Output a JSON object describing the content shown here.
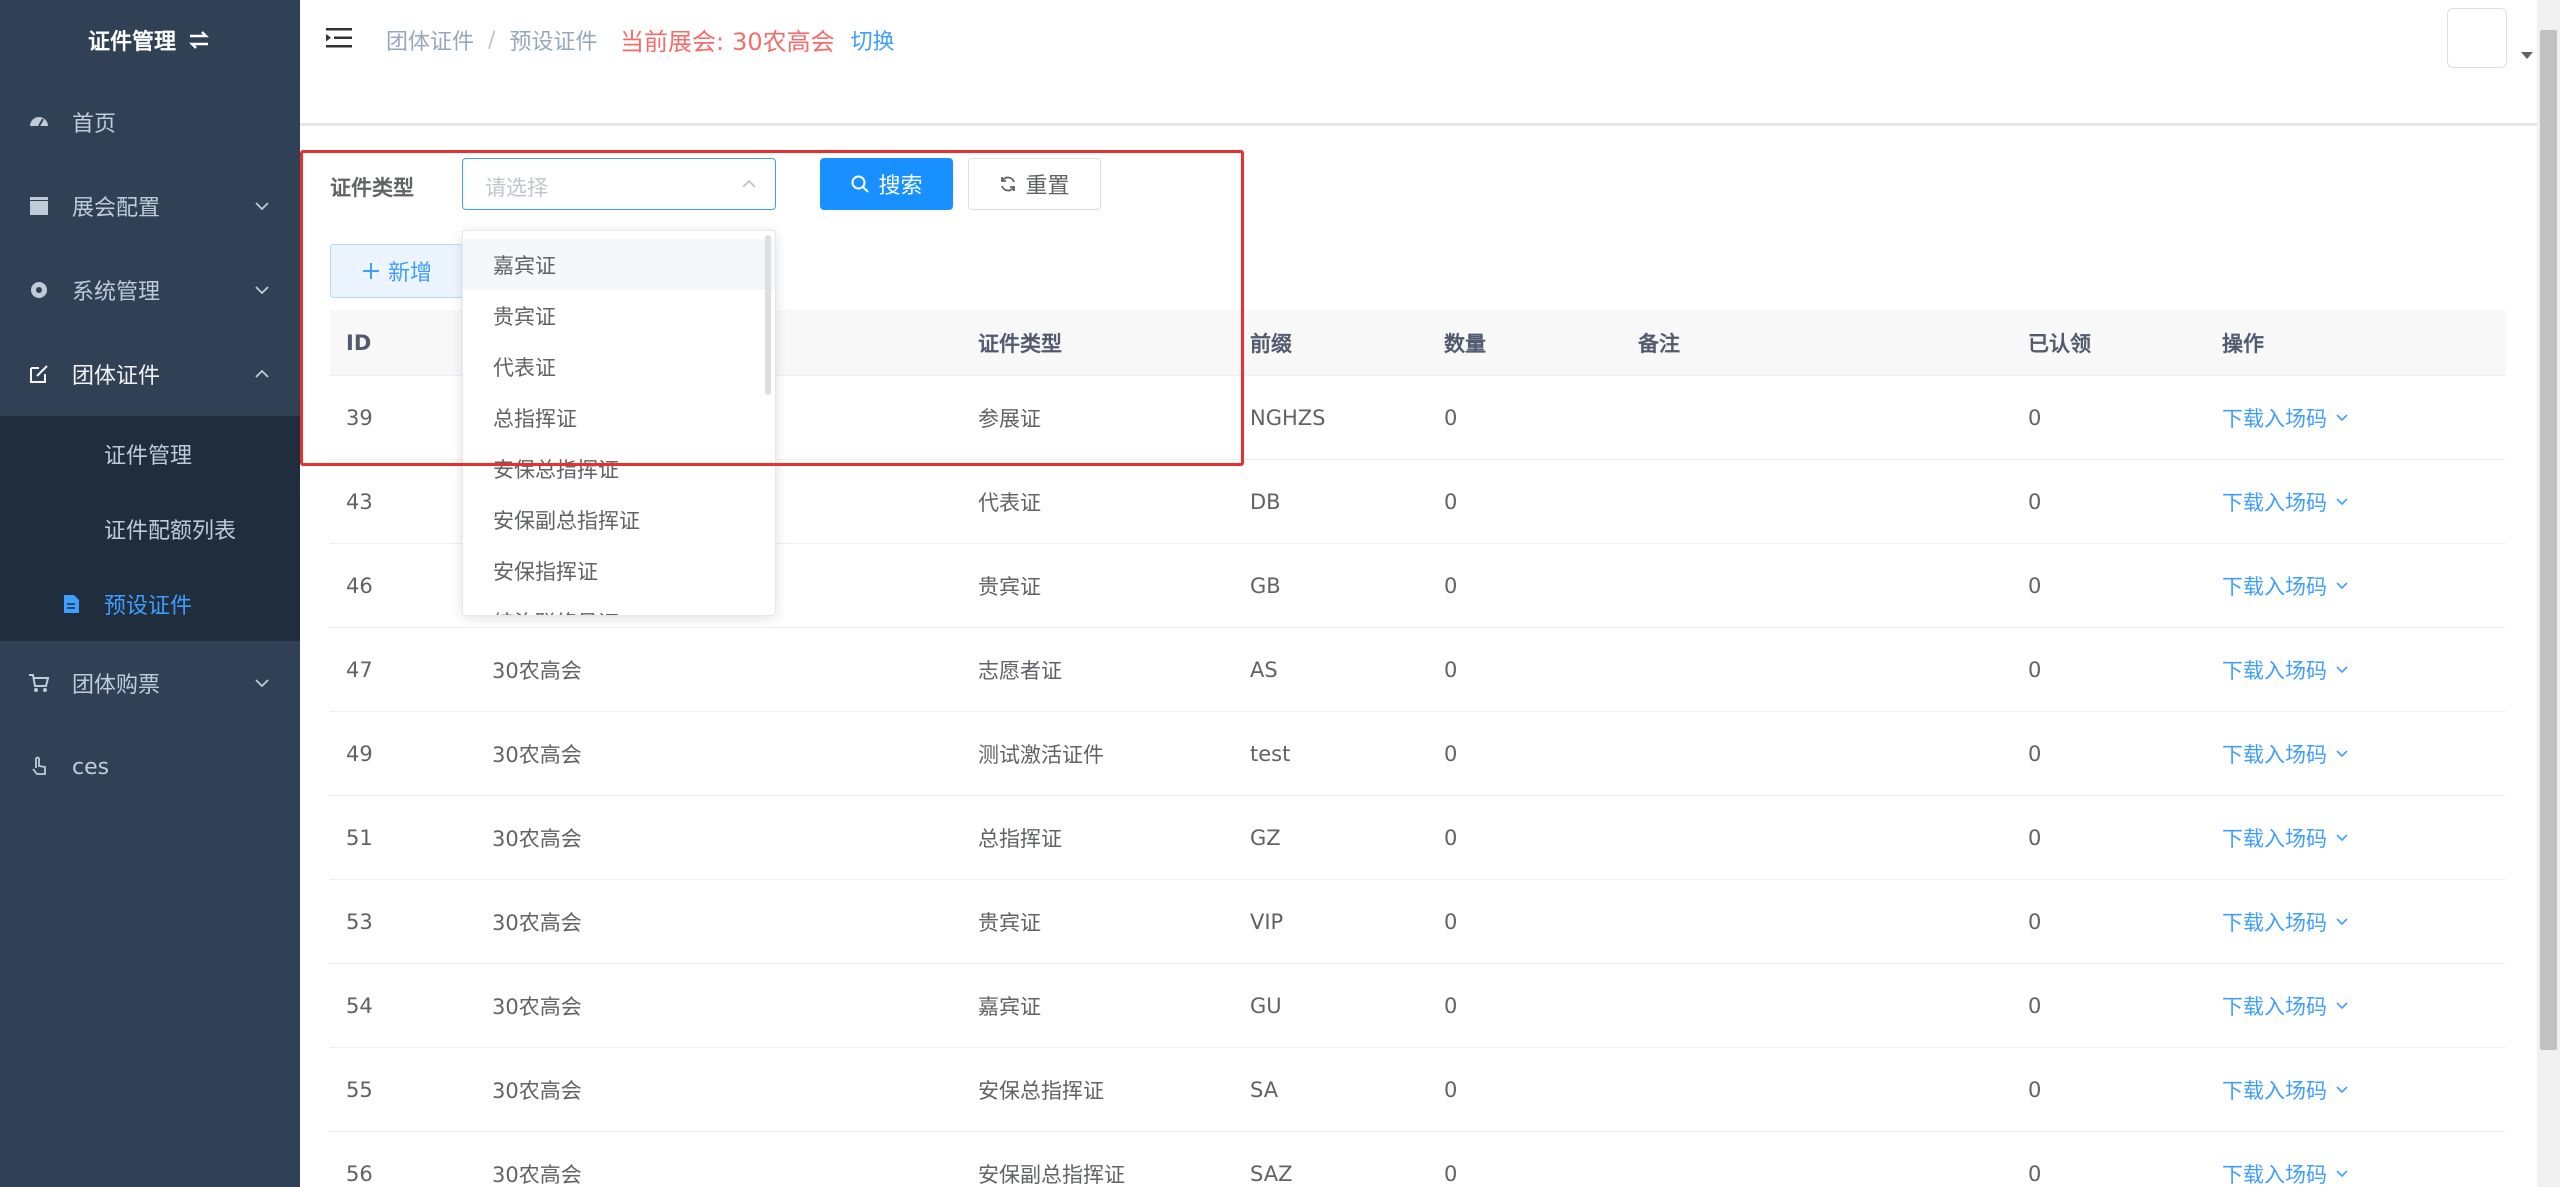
{
  "sidebar": {
    "brand": "证件管理",
    "items": [
      {
        "label": "首页"
      },
      {
        "label": "展会配置"
      },
      {
        "label": "系统管理"
      },
      {
        "label": "团体证件"
      },
      {
        "label": "团体购票"
      },
      {
        "label": "ces"
      }
    ],
    "sub_items": [
      {
        "label": "证件管理"
      },
      {
        "label": "证件配额列表"
      },
      {
        "label": "预设证件"
      }
    ]
  },
  "header": {
    "breadcrumb": [
      "团体证件",
      "预设证件"
    ],
    "current_expo_label": "当前展会:",
    "current_expo_value": "30农高会",
    "switch_label": "切换"
  },
  "filter": {
    "label": "证件类型",
    "placeholder": "请选择",
    "search_label": "搜索",
    "reset_label": "重置",
    "add_label": "新增"
  },
  "dropdown": {
    "options": [
      "嘉宾证",
      "贵宾证",
      "代表证",
      "总指挥证",
      "安保总指挥证",
      "安保副总指挥证",
      "安保指挥证",
      "综治联络员证"
    ]
  },
  "table": {
    "headers": [
      "ID",
      "",
      "证件类型",
      "前缀",
      "数量",
      "备注",
      "已认领",
      "操作"
    ],
    "rows": [
      {
        "id": "39",
        "expo": "",
        "type": "参展证",
        "prefix": "NGHZS",
        "qty": "0",
        "note": "",
        "claimed": "0",
        "op": "下载入场码"
      },
      {
        "id": "43",
        "expo": "",
        "type": "代表证",
        "prefix": "DB",
        "qty": "0",
        "note": "",
        "claimed": "0",
        "op": "下载入场码"
      },
      {
        "id": "46",
        "expo": "",
        "type": "贵宾证",
        "prefix": "GB",
        "qty": "0",
        "note": "",
        "claimed": "0",
        "op": "下载入场码"
      },
      {
        "id": "47",
        "expo": "30农高会",
        "type": "志愿者证",
        "prefix": "AS",
        "qty": "0",
        "note": "",
        "claimed": "0",
        "op": "下载入场码"
      },
      {
        "id": "49",
        "expo": "30农高会",
        "type": "测试激活证件",
        "prefix": "test",
        "qty": "0",
        "note": "",
        "claimed": "0",
        "op": "下载入场码"
      },
      {
        "id": "51",
        "expo": "30农高会",
        "type": "总指挥证",
        "prefix": "GZ",
        "qty": "0",
        "note": "",
        "claimed": "0",
        "op": "下载入场码"
      },
      {
        "id": "53",
        "expo": "30农高会",
        "type": "贵宾证",
        "prefix": "VIP",
        "qty": "0",
        "note": "",
        "claimed": "0",
        "op": "下载入场码"
      },
      {
        "id": "54",
        "expo": "30农高会",
        "type": "嘉宾证",
        "prefix": "GU",
        "qty": "0",
        "note": "",
        "claimed": "0",
        "op": "下载入场码"
      },
      {
        "id": "55",
        "expo": "30农高会",
        "type": "安保总指挥证",
        "prefix": "SA",
        "qty": "0",
        "note": "",
        "claimed": "0",
        "op": "下载入场码"
      },
      {
        "id": "56",
        "expo": "30农高会",
        "type": "安保副总指挥证",
        "prefix": "SAZ",
        "qty": "0",
        "note": "",
        "claimed": "0",
        "op": "下载入场码"
      }
    ]
  },
  "colors": {
    "sidebar_bg": "#304156",
    "submenu_bg": "#1f2d3d",
    "accent": "#409eff",
    "primary_button": "#1890ff",
    "highlight_red": "#e8302d",
    "expo_red": "#f56c6c"
  }
}
